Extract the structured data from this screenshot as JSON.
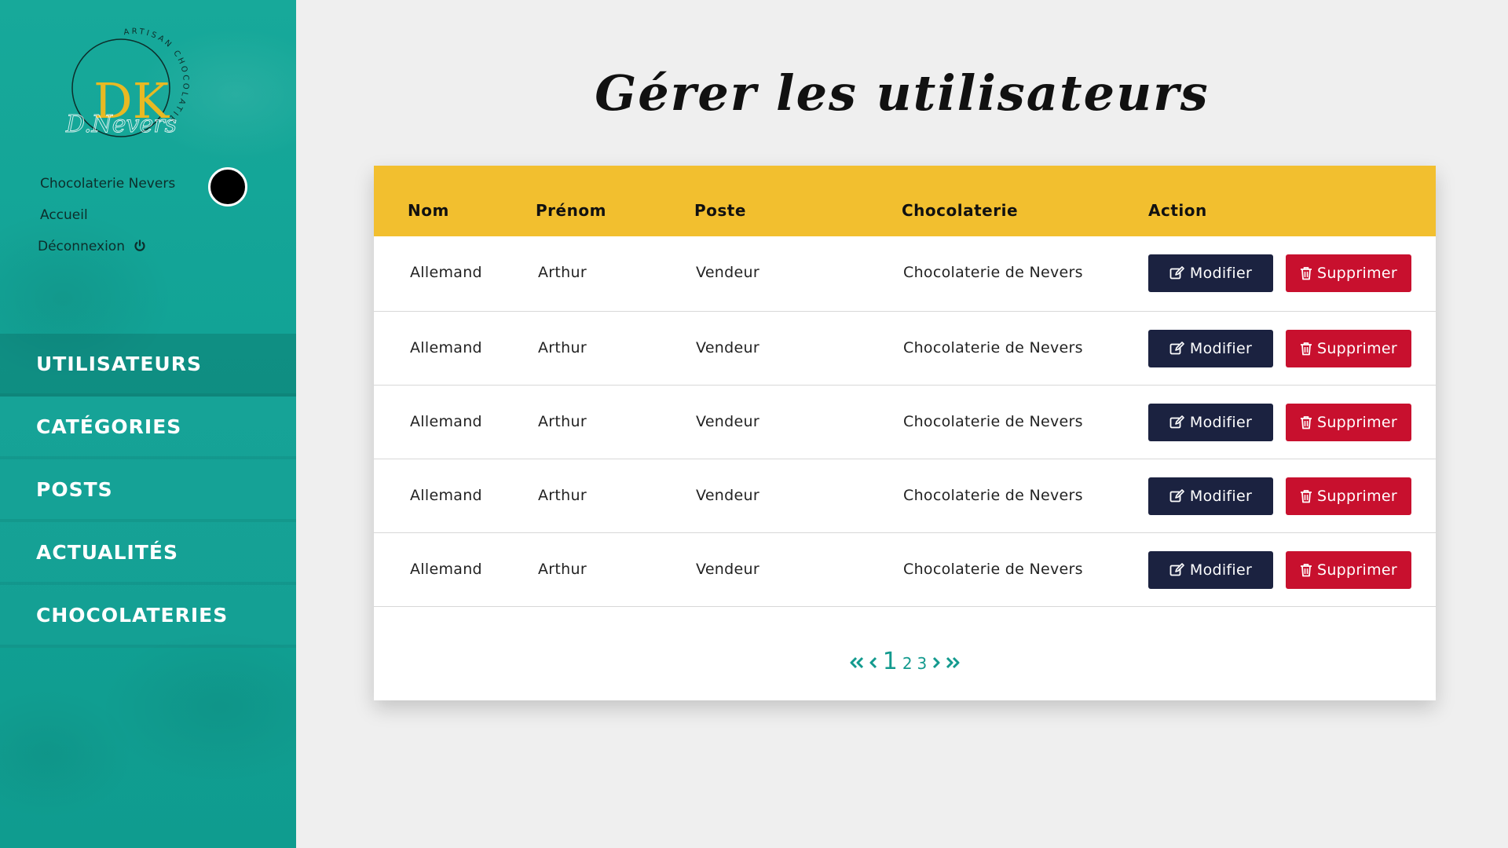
{
  "sidebar": {
    "logo": {
      "monogram": "DK",
      "ring_text": "ARTISAN CHOCOLATIER",
      "signature": "D.Nevers"
    },
    "brand_link": "Chocolaterie Nevers",
    "home_link": "Accueil",
    "logout_link": "Déconnexion",
    "nav": [
      {
        "label": "UTILISATEURS",
        "active": true
      },
      {
        "label": "CATÉGORIES",
        "active": false
      },
      {
        "label": "POSTS",
        "active": false
      },
      {
        "label": "ACTUALITÉS",
        "active": false
      },
      {
        "label": "CHOCOLATERIES",
        "active": false
      }
    ]
  },
  "page": {
    "title": "Gérer les utilisateurs"
  },
  "table": {
    "headers": {
      "nom": "Nom",
      "prenom": "Prénom",
      "poste": "Poste",
      "chocolaterie": "Chocolaterie",
      "action": "Action"
    },
    "rows": [
      {
        "nom": "Allemand",
        "prenom": "Arthur",
        "poste": "Vendeur",
        "chocolaterie": "Chocolaterie de Nevers"
      },
      {
        "nom": "Allemand",
        "prenom": "Arthur",
        "poste": "Vendeur",
        "chocolaterie": "Chocolaterie de Nevers"
      },
      {
        "nom": "Allemand",
        "prenom": "Arthur",
        "poste": "Vendeur",
        "chocolaterie": "Chocolaterie de Nevers"
      },
      {
        "nom": "Allemand",
        "prenom": "Arthur",
        "poste": "Vendeur",
        "chocolaterie": "Chocolaterie de Nevers"
      },
      {
        "nom": "Allemand",
        "prenom": "Arthur",
        "poste": "Vendeur",
        "chocolaterie": "Chocolaterie de Nevers"
      }
    ],
    "edit_label": "Modifier",
    "delete_label": "Supprimer"
  },
  "pagination": {
    "pages": [
      "1",
      "2",
      "3"
    ],
    "current": "1"
  },
  "colors": {
    "sidebar_teal": "#12a396",
    "header_yellow": "#f2bf2f",
    "edit_navy": "#1b2240",
    "delete_red": "#c8102e",
    "pagination_teal": "#139a8e",
    "logo_gold": "#e8b923"
  },
  "icons": {
    "logout": "power-icon",
    "edit": "edit-icon",
    "delete": "trash-icon",
    "first": "double-chevron-left-icon",
    "prev": "chevron-left-icon",
    "next": "chevron-right-icon",
    "last": "double-chevron-right-icon"
  }
}
